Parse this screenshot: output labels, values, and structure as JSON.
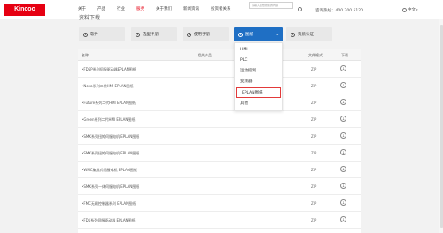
{
  "header": {
    "logo": "Kincoo",
    "nav": [
      "关于",
      "产品",
      "行业",
      "服务",
      "关于我们",
      "新闻资讯",
      "投资者关系"
    ],
    "active_nav_index": 3,
    "search_placeholder": "请输入您想搜索的内容",
    "hotline": "咨询热线：400 700 5120",
    "language": "中文"
  },
  "breadcrumb": "资料下载",
  "categories": [
    {
      "label": "软件",
      "icon": "software-icon"
    },
    {
      "label": "选型手册",
      "icon": "catalog-icon"
    },
    {
      "label": "使用手册",
      "icon": "manual-icon"
    },
    {
      "label": "图纸",
      "icon": "drawing-icon",
      "active": true
    },
    {
      "label": "资质认证",
      "icon": "certificate-icon"
    }
  ],
  "dropdown": {
    "items": [
      "HMI",
      "PLC",
      "运动控制",
      "变频器",
      "EPLAN图纸",
      "其他"
    ],
    "highlight_index": 4
  },
  "table": {
    "headers": [
      "名称",
      "相关产品",
      "文件格式",
      "下载"
    ],
    "rows": [
      {
        "name": "•FD5P系列伺服驱动器EPLAN图纸",
        "type": "ZIP"
      },
      {
        "name": "•Nova系列二代HMI EPLAN图纸",
        "type": "ZIP"
      },
      {
        "name": "•Future系列二代HMI EPLAN图纸",
        "type": "ZIP"
      },
      {
        "name": "•Green系列二代HMI EPLAN图纸",
        "type": "ZIP"
      },
      {
        "name": "•SMK系列扭矩伺服电机 EPLAN图纸",
        "type": "ZIP"
      },
      {
        "name": "•SMK系列扭矩伺服电机 EPLAN图纸",
        "type": "ZIP"
      },
      {
        "name": "•WMC集成式伺服电机 EPLAN图纸",
        "type": "ZIP"
      },
      {
        "name": "•SMK系列一体伺服电机 EPLAN图纸",
        "type": "ZIP"
      },
      {
        "name": "•FMC无刷控制器系列 EPLAN图纸",
        "type": "ZIP"
      },
      {
        "name": "•FD1系列伺服驱动器 EPLAN图纸",
        "type": "ZIP"
      }
    ]
  },
  "colors": {
    "brand": "#e60012",
    "active_tab": "#1f6fc4",
    "highlight_border": "#e23a3a"
  }
}
